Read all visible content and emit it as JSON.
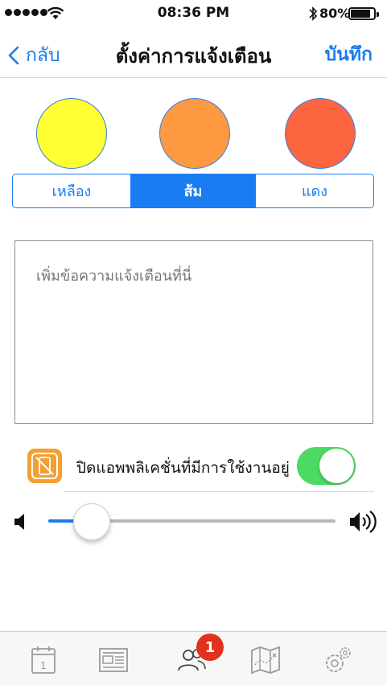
{
  "status_bar": {
    "time": "08:36 PM",
    "battery": "80%",
    "signal_icon": "signal-dots-icon",
    "wifi_icon": "wifi-icon",
    "bluetooth_icon": "bluetooth-icon"
  },
  "nav": {
    "back_label": "กลับ",
    "title": "ตั้งค่าการแจ้งเตือน",
    "save_label": "บันทึก"
  },
  "colors": {
    "accent": "#1a7cf1",
    "yellow": "#ffff33",
    "orange": "#fd9940",
    "red": "#fc653f",
    "toggle_on": "#4cd964",
    "badge": "#e0321c"
  },
  "segments": [
    {
      "label": "เหลือง",
      "selected": false
    },
    {
      "label": "ส้ม",
      "selected": true
    },
    {
      "label": "แดง",
      "selected": false
    }
  ],
  "message": {
    "placeholder": "เพิ่มข้อความแจ้งเตือนที่นี่"
  },
  "setting": {
    "label": "ปิดแอพพลิเคชั่นที่มีการใช้งานอยู่",
    "enabled": true,
    "icon": "no-phone-icon"
  },
  "volume": {
    "level": 0.15,
    "low_icon": "speaker-low-icon",
    "high_icon": "speaker-high-icon"
  },
  "tabbar": {
    "tabs": [
      {
        "name": "calendar",
        "icon": "calendar-icon",
        "day": "1"
      },
      {
        "name": "news",
        "icon": "news-icon"
      },
      {
        "name": "people",
        "icon": "people-icon",
        "badge": "1",
        "active": true
      },
      {
        "name": "map",
        "icon": "map-icon"
      },
      {
        "name": "settings",
        "icon": "gear-icon"
      }
    ]
  }
}
